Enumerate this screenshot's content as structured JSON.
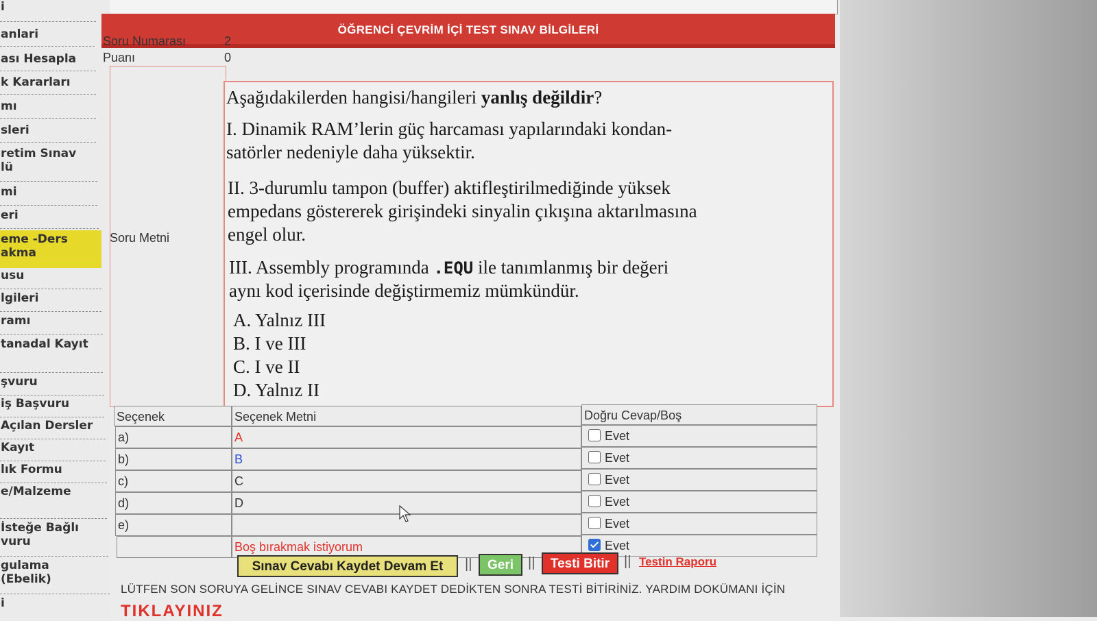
{
  "sidebar": {
    "items": [
      {
        "label": "i"
      },
      {
        "label": "anlari"
      },
      {
        "label": "ası Hesapla"
      },
      {
        "label": "k Kararları"
      },
      {
        "label": "mı"
      },
      {
        "label": "sleri"
      },
      {
        "label": "retim Sınav\nlü"
      },
      {
        "label": "mi"
      },
      {
        "label": "eri"
      },
      {
        "label": "eme -Ders\nakma"
      },
      {
        "label": "usu"
      },
      {
        "label": "lgileri"
      },
      {
        "label": "ramı"
      },
      {
        "label": "tanadal Kayıt"
      },
      {
        "label": "şvuru"
      },
      {
        "label": "iş Başvuru"
      },
      {
        "label": "Açılan Dersler"
      },
      {
        "label": "Kayıt"
      },
      {
        "label": "lık Formu"
      },
      {
        "label": "e/Malzeme"
      },
      {
        "label": "İsteğe Bağlı\nvuru"
      },
      {
        "label": "gulama\n(Ebelik)"
      },
      {
        "label": "i"
      }
    ],
    "active_index": 9
  },
  "header": {
    "title": "ÖĞRENCİ ÇEVRİM İÇİ TEST SINAV BİLGİLERİ"
  },
  "meta": {
    "question_number_label": "Soru Numarası",
    "question_number": "2",
    "score_label": "Puanı",
    "score": "0"
  },
  "question": {
    "label": "Soru Metni",
    "stem_prefix": "Aşağıdakilerden hangisi/hangileri ",
    "stem_bold": "yanlış değildir",
    "stem_suffix": "?",
    "item1_line1": "I. Dinamik RAM’lerin güç harcaması yapılarındaki kondan-",
    "item1_line2": "satörler nedeniyle daha yüksektir.",
    "item2_line1": "II. 3-durumlu tampon (buffer) aktifleştirilmediğinde yüksek",
    "item2_line2": "empedans göstererek girişindeki sinyalin çıkışına aktarılmasına",
    "item2_line3": "engel olur.",
    "item3_line1_prefix": "III. Assembly programında ",
    "item3_code": ".EQU",
    "item3_line1_suffix": " ile tanımlanmış bir değeri",
    "item3_line2": "aynı kod içerisinde değiştirmemiz mümkündür.",
    "choices": [
      "A. Yalnız III",
      "B. I ve III",
      "C. I ve II",
      "D. Yalnız II"
    ]
  },
  "options_table": {
    "headers": {
      "option": "Seçenek",
      "text": "Seçenek Metni",
      "answer": "Doğru Cevap/Boş"
    },
    "rows": [
      {
        "option": "a)",
        "text": "A",
        "answer": "Evet",
        "checked": false
      },
      {
        "option": "b)",
        "text": "B",
        "answer": "Evet",
        "checked": false
      },
      {
        "option": "c)",
        "text": "C",
        "answer": "Evet",
        "checked": false
      },
      {
        "option": "d)",
        "text": "D",
        "answer": "Evet",
        "checked": false
      },
      {
        "option": "e)",
        "text": "",
        "answer": "Evet",
        "checked": false
      },
      {
        "option": "",
        "text": "Boş bırakmak istiyorum",
        "answer": "Evet",
        "checked": true
      }
    ]
  },
  "actions": {
    "save": "Sınav Cevabı Kaydet Devam Et",
    "separator": "||",
    "back": "Geri",
    "finish": "Testi Bitir",
    "report": "Testin Raporu"
  },
  "footer": {
    "note": "LÜTFEN SON SORUYA GELİNCE SINAV CEVABI KAYDET DEDİKTEN SONRA TESTİ BİTİRİNİZ. YARDIM DOKÜMANI İÇİN",
    "cta": "TIKLAYINIZ"
  },
  "colors": {
    "header": "#cf3a33",
    "active_sidebar": "#e6d92a",
    "save_button": "#e8e07a",
    "back_button": "#7cc468",
    "finish_button": "#e0322b"
  }
}
